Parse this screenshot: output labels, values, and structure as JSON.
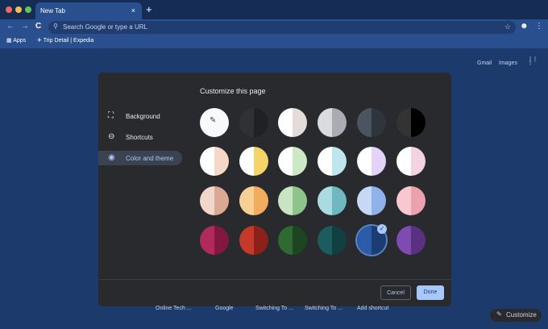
{
  "window": {
    "traffic": [
      "#ed6a5e",
      "#f5bf4f",
      "#62c554"
    ]
  },
  "tab": {
    "title": "New Tab",
    "close": "×",
    "new": "+"
  },
  "toolbar": {
    "back": "←",
    "forward": "→",
    "reload": "C",
    "search_icon": "⚲",
    "placeholder": "Search Google or type a URL",
    "star": "☆",
    "profile": "☻",
    "menu": "⋮"
  },
  "bookmarks": [
    {
      "label": "Apps",
      "icon": "▦"
    },
    {
      "label": "Trip Detail | Expedia",
      "icon": "✈"
    }
  ],
  "top_links": {
    "gmail": "Gmail",
    "images": "Images",
    "apps": "⋮⋮⋮"
  },
  "modal": {
    "title": "Customize this page",
    "sidebar": [
      {
        "label": "Background",
        "icon": "⛶"
      },
      {
        "label": "Shortcuts",
        "icon": "⊖"
      },
      {
        "label": "Color and theme",
        "icon": "◉",
        "selected": true
      }
    ],
    "themes": [
      [
        [
          "#f8f9fa",
          "#f8f9fa"
        ],
        [
          "#2f3134",
          "#1f2124"
        ],
        [
          "#ffffff",
          "#e4dcd8"
        ],
        [
          "#d9dbde",
          "#a9acb3"
        ],
        [
          "#4a5560",
          "#2e353c"
        ],
        [
          "#333333",
          "#000000"
        ]
      ],
      [
        [
          "#ffffff",
          "#f6d8c8"
        ],
        [
          "#ffffff",
          "#f5d46a"
        ],
        [
          "#ffffff",
          "#cde8c4"
        ],
        [
          "#ffffff",
          "#bfe6ef"
        ],
        [
          "#ffffff",
          "#e4d2f8"
        ],
        [
          "#ffffff",
          "#f2d3df"
        ]
      ],
      [
        [
          "#f3d6cb",
          "#dba894"
        ],
        [
          "#f8cf95",
          "#f0ad5d"
        ],
        [
          "#c8e5c3",
          "#8ec38b"
        ],
        [
          "#a8dce0",
          "#6fb8bf"
        ],
        [
          "#c5d9f6",
          "#8fb2ea"
        ],
        [
          "#f7c8d0",
          "#eba2af"
        ]
      ],
      [
        [
          "#b22a5c",
          "#82173f"
        ],
        [
          "#c4392a",
          "#8c2119"
        ],
        [
          "#2f6a31",
          "#1c4520"
        ],
        [
          "#1c5c5e",
          "#123f42"
        ],
        [
          "#2a5ca8",
          "#1c3d72"
        ],
        [
          "#7e4bb0",
          "#5a3080"
        ]
      ]
    ],
    "selected_theme": [
      3,
      4
    ],
    "cancel": "Cancel",
    "done": "Done",
    "picker_icon": "✎",
    "check": "✓"
  },
  "shortcuts": [
    "Online Tech ...",
    "Google",
    "Switching To ...",
    "Switching To ...",
    "Add shortcut"
  ],
  "customize": {
    "label": "Customize",
    "icon": "✎"
  }
}
